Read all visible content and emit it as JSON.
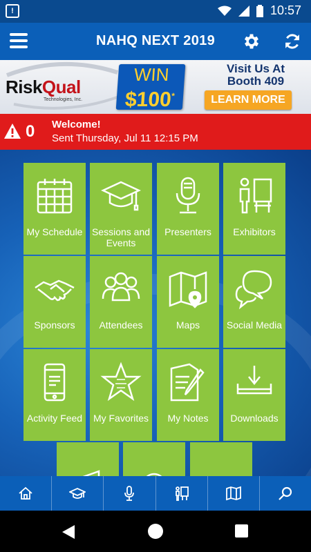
{
  "status_bar": {
    "time": "10:57",
    "notification_glyph": "!"
  },
  "app_bar": {
    "title": "NAHQ NEXT 2019",
    "icons": [
      "menu-icon",
      "gear-icon",
      "refresh-icon"
    ]
  },
  "banner": {
    "logo_risk": "Risk",
    "logo_qual": "Qual",
    "logo_sub": "Technologies, Inc.",
    "win_line1": "WIN",
    "win_line2": "$100",
    "win_star": "*",
    "visit_line1": "Visit Us At",
    "visit_line2": "Booth 409",
    "cta": "LEARN MORE"
  },
  "alert": {
    "count": "0",
    "title": "Welcome!",
    "subtitle": "Sent Thursday, Jul 11 12:15 PM"
  },
  "tiles": [
    {
      "label": "My Schedule",
      "icon": "calendar-icon"
    },
    {
      "label": "Sessions and Events",
      "icon": "graduation-cap-icon"
    },
    {
      "label": "Presenters",
      "icon": "microphone-icon"
    },
    {
      "label": "Exhibitors",
      "icon": "exhibitor-booth-icon"
    },
    {
      "label": "Sponsors",
      "icon": "handshake-icon"
    },
    {
      "label": "Attendees",
      "icon": "people-icon"
    },
    {
      "label": "Maps",
      "icon": "map-icon"
    },
    {
      "label": "Social Media",
      "icon": "chat-bubbles-icon"
    },
    {
      "label": "Activity Feed",
      "icon": "phone-icon"
    },
    {
      "label": "My Favorites",
      "icon": "star-icon"
    },
    {
      "label": "My Notes",
      "icon": "notes-icon"
    },
    {
      "label": "Downloads",
      "icon": "download-icon"
    },
    {
      "label": "",
      "icon": "megaphone-icon"
    },
    {
      "label": "",
      "icon": "help-icon"
    },
    {
      "label": "",
      "icon": "share-icon"
    }
  ],
  "bottom_nav": [
    "home-icon",
    "graduation-cap-icon",
    "microphone-icon",
    "exhibitor-booth-icon",
    "map-icon",
    "search-icon"
  ],
  "colors": {
    "header": "#0b5fb8",
    "status_bar": "#0a4a8f",
    "tile": "#8dc63f",
    "alert": "#e01b1b",
    "cta": "#f6a623"
  }
}
